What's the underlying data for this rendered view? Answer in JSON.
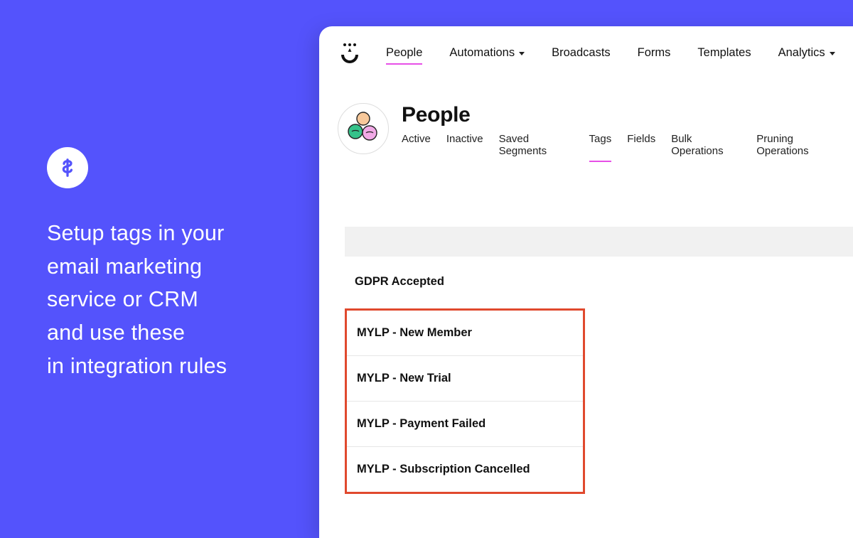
{
  "left": {
    "line1": "Setup tags in your",
    "line2": "email marketing",
    "line3": "service or CRM",
    "line4": "and use these",
    "line5": "in integration rules"
  },
  "nav": {
    "people": "People",
    "automations": "Automations",
    "broadcasts": "Broadcasts",
    "forms": "Forms",
    "templates": "Templates",
    "analytics": "Analytics"
  },
  "page": {
    "title": "People"
  },
  "subtabs": {
    "active": "Active",
    "inactive": "Inactive",
    "saved": "Saved Segments",
    "tags": "Tags",
    "fields": "Fields",
    "bulk": "Bulk Operations",
    "pruning": "Pruning Operations"
  },
  "tags": {
    "gdpr": "GDPR Accepted",
    "highlighted": [
      "MYLP - New Member",
      "MYLP - New Trial",
      "MYLP - Payment Failed",
      "MYLP - Subscription Cancelled"
    ]
  }
}
